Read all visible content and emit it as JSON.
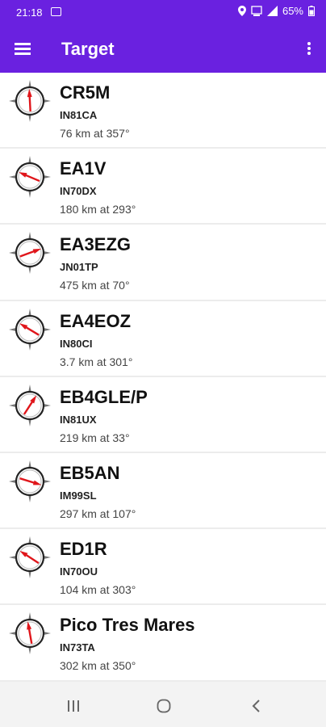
{
  "status": {
    "time": "21:18",
    "battery": "65%"
  },
  "app_bar": {
    "title": "Target"
  },
  "targets": [
    {
      "callsign": "CR5M",
      "locator": "IN81CA",
      "distance": "76 km at 357°",
      "bearing": 357
    },
    {
      "callsign": "EA1V",
      "locator": "IN70DX",
      "distance": "180 km at 293°",
      "bearing": 293
    },
    {
      "callsign": "EA3EZG",
      "locator": "JN01TP",
      "distance": "475 km at 70°",
      "bearing": 70
    },
    {
      "callsign": "EA4EOZ",
      "locator": "IN80CI",
      "distance": "3.7 km at 301°",
      "bearing": 301
    },
    {
      "callsign": "EB4GLE/P",
      "locator": "IN81UX",
      "distance": "219 km at 33°",
      "bearing": 33
    },
    {
      "callsign": "EB5AN",
      "locator": "IM99SL",
      "distance": "297 km at 107°",
      "bearing": 107
    },
    {
      "callsign": "ED1R",
      "locator": "IN70OU",
      "distance": "104 km at 303°",
      "bearing": 303
    },
    {
      "callsign": "Pico Tres Mares",
      "locator": "IN73TA",
      "distance": "302 km at 350°",
      "bearing": 350
    }
  ],
  "colors": {
    "primary": "#6a21e0",
    "needle": "#e0161b"
  }
}
